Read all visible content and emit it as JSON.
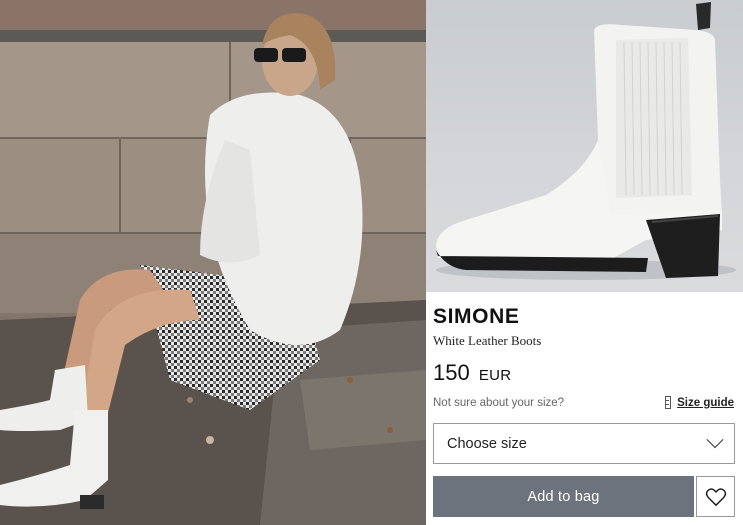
{
  "product": {
    "name": "SIMONE",
    "subtitle": "White Leather Boots",
    "price_amount": "150",
    "price_currency": "EUR"
  },
  "size": {
    "hint": "Not sure about your size?",
    "guide_label": "Size guide",
    "select_value": "Choose size"
  },
  "actions": {
    "add_to_bag": "Add to bag"
  },
  "icons": {
    "size_guide": "ruler-icon",
    "select": "chevron-down-icon",
    "wishlist": "heart-icon"
  },
  "colors": {
    "add_to_bag_bg": "#6d737d",
    "border": "#9a9a9a",
    "text": "#111111"
  }
}
